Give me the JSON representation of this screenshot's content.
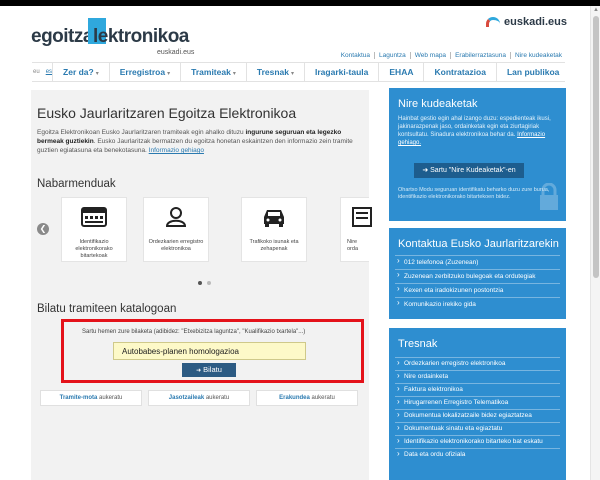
{
  "logo": {
    "part1": "egoitza",
    "part2": "lektronikoa",
    "sub": "euskadi.eus"
  },
  "brand": {
    "label": "euskadi.eus"
  },
  "util_links": [
    "Kontaktua",
    "Laguntza",
    "Web mapa",
    "Erabilerraztasuna",
    "Nire kudeaketak"
  ],
  "langs": {
    "items": [
      "eu",
      "es"
    ]
  },
  "nav": {
    "items": [
      "Zer da?",
      "Erregistroa",
      "Tramiteak",
      "Tresnak",
      "Iragarki-taula",
      "EHAA",
      "Kontratazioa",
      "Lan publikoa"
    ],
    "dropdown_flags": [
      true,
      true,
      true,
      true,
      false,
      false,
      false,
      false
    ]
  },
  "main": {
    "title": "Eusko Jaurlaritzaren Egoitza Elektronikoa",
    "intro_a": "Egoitza Elektronikoan Eusko Jaurlaritzaren tramiteak egin ahalko dituzu ",
    "intro_bold": "ingurune seguruan eta legezko bermeak guztiekin",
    "intro_b": ". Eusko Jaurlaritzak bermatzen du egoitza honetan eskaintzen den informazio zein tramite guztien egiatasuna eta benekotasuna. ",
    "intro_link": "Informazio gehiago",
    "featured_title": "Nabarmenduak",
    "featured": [
      {
        "label": "Identifikazio elektronikorako bitartekoak",
        "icon": "id-card-icon"
      },
      {
        "label": "Ordezkarien erregistro elektronikoa",
        "icon": "person-icon"
      },
      {
        "label": "Trafikoko isunak eta zehapenak",
        "icon": "car-icon"
      },
      {
        "label": "Nire orda",
        "icon": "document-icon"
      }
    ],
    "search_title": "Bilatu tramiteen katalogoan",
    "search_hint": "Sartu hemen zure bilaketa (adibidez: \"Etxebizitza laguntza\", \"Kualifikazio txartela\"...)",
    "search_value": "Autobabes-planen homologazioa",
    "search_button": "Bilatu",
    "tabs": [
      {
        "bold": "Tramite-mota",
        "rest": " aukeratu"
      },
      {
        "bold": "Jasotzaileak",
        "rest": " aukeratu"
      },
      {
        "bold": "Erakundea",
        "rest": " aukeratu"
      }
    ]
  },
  "side": {
    "box1_title": "Nire kudeaketak",
    "box1_text": "Hainbat gestio egin ahal izango duzu: espedienteak ikusi, jakinarazpenak jaso, ordainketak egin eta ziurtagiriak kontsultatu. Sinadura elektronikoa behar da. ",
    "box1_link": "Informazio gehiago.",
    "box1_button": "Sartu \"Nire Kudeaketak\"-en",
    "box1_note": "Ohartxo Modu seguruan identifikatu beharko duzu zure burua, identifikazio elektronikorako bitartekoen bidez.",
    "box2_title": "Kontaktua Eusko Jaurlaritzarekin",
    "box2_items": [
      "012 telefonoa (Zuzenean)",
      "Zuzenean zerbitzuko bulegoak eta ordutegiak",
      "Kexen eta iradokizunen postontzia",
      "Komunikazio irekiko gida"
    ],
    "box3_title": "Tresnak",
    "box3_items": [
      "Ordezkarien erregistro elektronikoa",
      "Nire ordainketa",
      "Faktura elektronikoa",
      "Hirugarrenen Erregistro Telematikoa",
      "Dokumentua lokalizatzaile bidez egiaztatzea",
      "Dokumentuak sinatu eta egiaztatu",
      "Identifikazio elektronikorako bitarteko bat eskatu",
      "Data eta ordu ofiziala"
    ]
  },
  "colors": {
    "accent": "#2fa8dd",
    "side_blue": "#2e8ed0",
    "nav_link": "#2a7ab0",
    "highlight": "#e4121a"
  }
}
